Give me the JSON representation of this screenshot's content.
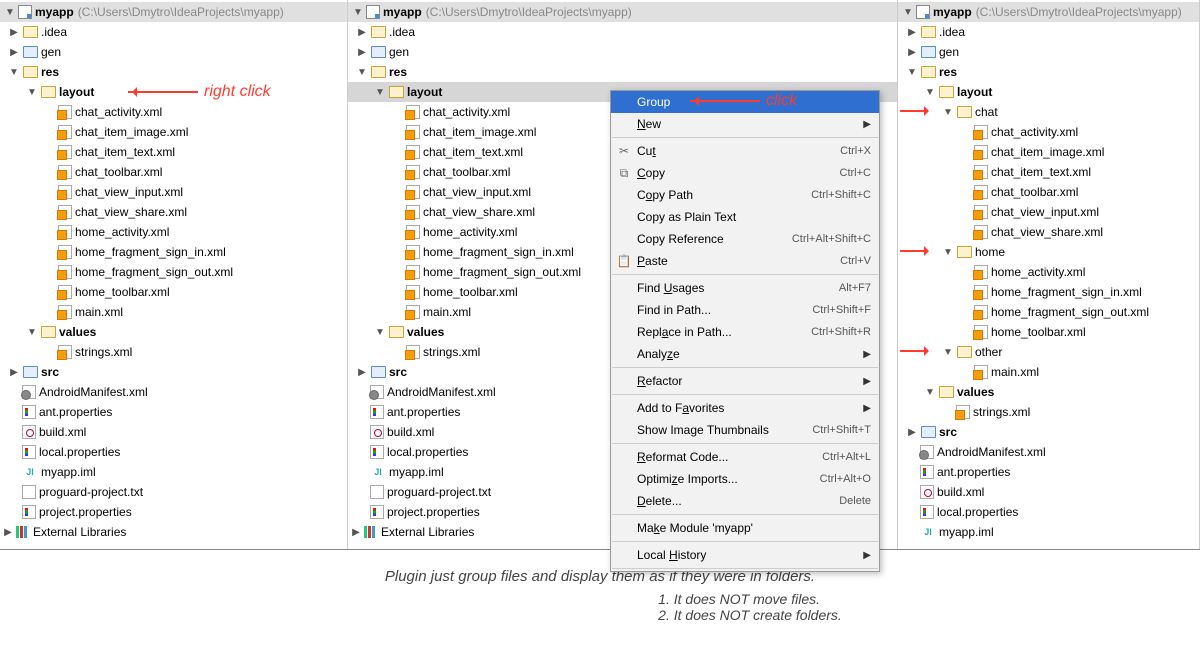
{
  "project": {
    "name": "myapp",
    "path": "(C:\\Users\\Dmytro\\IdeaProjects\\myapp)"
  },
  "annotations": {
    "right_click": "right click",
    "click": "click"
  },
  "tree": {
    "idea": ".idea",
    "gen": "gen",
    "res": "res",
    "layout": "layout",
    "values": "values",
    "src": "src",
    "ext_libs": "External Libraries",
    "strings": "strings.xml",
    "android_manifest": "AndroidManifest.xml",
    "ant_props": "ant.properties",
    "build_xml": "build.xml",
    "local_props": "local.properties",
    "myapp_iml": "myapp.iml",
    "proguard": "proguard-project.txt",
    "project_props": "project.properties"
  },
  "layout_files": [
    "chat_activity.xml",
    "chat_item_image.xml",
    "chat_item_text.xml",
    "chat_toolbar.xml",
    "chat_view_input.xml",
    "chat_view_share.xml",
    "home_activity.xml",
    "home_fragment_sign_in.xml",
    "home_fragment_sign_out.xml",
    "home_toolbar.xml",
    "main.xml"
  ],
  "grouped": {
    "chat_label": "chat",
    "chat": [
      "chat_activity.xml",
      "chat_item_image.xml",
      "chat_item_text.xml",
      "chat_toolbar.xml",
      "chat_view_input.xml",
      "chat_view_share.xml"
    ],
    "home_label": "home",
    "home": [
      "home_activity.xml",
      "home_fragment_sign_in.xml",
      "home_fragment_sign_out.xml",
      "home_toolbar.xml"
    ],
    "other_label": "other",
    "other": [
      "main.xml"
    ]
  },
  "menu": {
    "group": "Group",
    "new": "New",
    "cut": "Cut",
    "cut_sc": "Ctrl+X",
    "copy": "Copy",
    "copy_sc": "Ctrl+C",
    "copy_path": "Copy Path",
    "copy_path_sc": "Ctrl+Shift+C",
    "copy_plain": "Copy as Plain Text",
    "copy_ref": "Copy Reference",
    "copy_ref_sc": "Ctrl+Alt+Shift+C",
    "paste": "Paste",
    "paste_sc": "Ctrl+V",
    "find_usages": "Find Usages",
    "find_usages_sc": "Alt+F7",
    "find_in_path": "Find in Path...",
    "find_in_path_sc": "Ctrl+Shift+F",
    "replace_in_path": "Replace in Path...",
    "replace_in_path_sc": "Ctrl+Shift+R",
    "analyze": "Analyze",
    "refactor": "Refactor",
    "add_fav": "Add to Favorites",
    "show_thumbs": "Show Image Thumbnails",
    "show_thumbs_sc": "Ctrl+Shift+T",
    "reformat": "Reformat Code...",
    "reformat_sc": "Ctrl+Alt+L",
    "optimize": "Optimize Imports...",
    "optimize_sc": "Ctrl+Alt+O",
    "delete": "Delete...",
    "delete_sc": "Delete",
    "make_module": "Make Module 'myapp'",
    "local_history": "Local History"
  },
  "footer": {
    "tagline": "Plugin just group files and display them as if they were in folders.",
    "note1": "1. It does NOT move files.",
    "note2": "2. It does NOT create folders."
  }
}
